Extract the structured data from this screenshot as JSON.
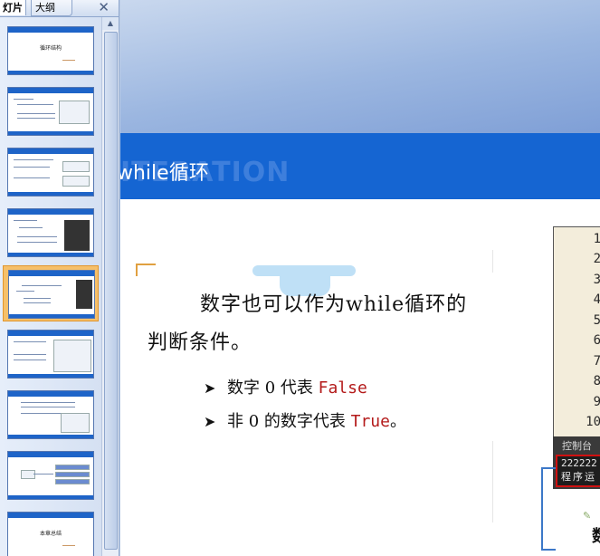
{
  "panel": {
    "tabs": [
      "灯片",
      "大纲"
    ],
    "close_glyph": "✕",
    "thumb_title_first": "循环结构",
    "thumb_title_last": "本章总结"
  },
  "slide": {
    "banner_ghost": "ITERATION",
    "title": "while循环",
    "line1": "数字也可以作为while循环的",
    "line2": "判断条件。",
    "bullets": [
      {
        "pre": "数字 0 代表 ",
        "kw": "False",
        "post": ""
      },
      {
        "pre": "非 0 的数字代表 ",
        "kw": "True",
        "post": "。"
      }
    ],
    "code_line_numbers": [
      "1",
      "2",
      "3",
      "4",
      "5",
      "6",
      "7",
      "8",
      "9",
      "10"
    ],
    "console_title": "控制台",
    "console_output": [
      "222222",
      "程序运"
    ],
    "bottom_text": "数"
  },
  "colors": {
    "banner_blue": "#1565d2",
    "keyword_red": "#b41b1b",
    "selected_thumb": "#f6c06a"
  }
}
